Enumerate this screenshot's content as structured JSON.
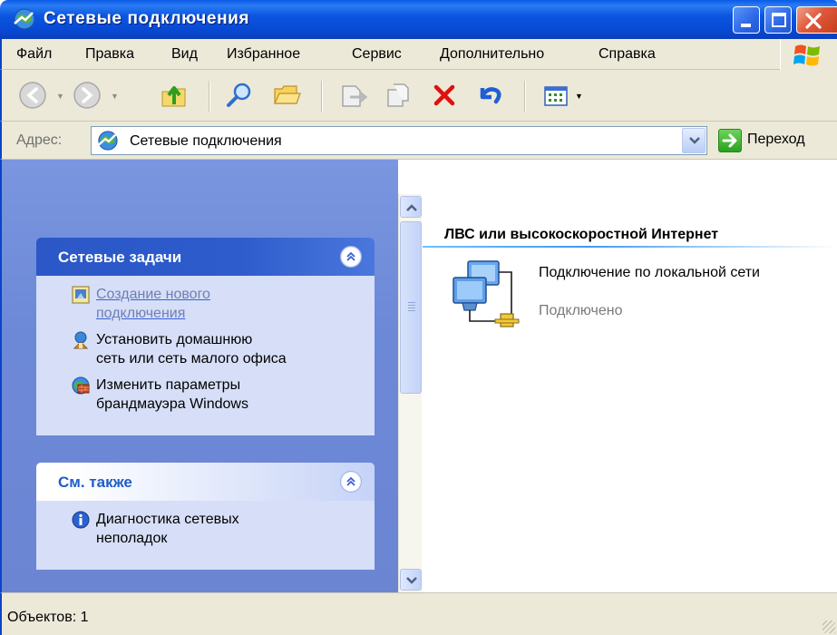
{
  "window": {
    "title": "Сетевые подключения",
    "controls": {
      "minimize": "minimize",
      "maximize": "maximize",
      "close": "close"
    }
  },
  "menu": {
    "items": [
      "Файл",
      "Правка",
      "Вид",
      "Избранное",
      "Сервис",
      "Дополнительно",
      "Справка"
    ]
  },
  "toolbar": {
    "icons": [
      "back-icon",
      "forward-icon",
      "up-folder-icon",
      "search-icon",
      "folders-icon",
      "move-to-icon",
      "copy-to-icon",
      "delete-icon",
      "undo-icon",
      "views-icon"
    ]
  },
  "address": {
    "label": "Адрес:",
    "value": "Сетевые подключения",
    "go_label": "Переход"
  },
  "left_pane": {
    "network_tasks": {
      "title": "Сетевые задачи",
      "items": [
        {
          "line1": "Создание нового",
          "line2": "подключения",
          "icon": "new-connection-icon",
          "disabled": true
        },
        {
          "line1": "Установить домашнюю",
          "line2": "сеть или сеть малого офиса",
          "icon": "home-network-icon"
        },
        {
          "line1": "Изменить параметры",
          "line2": "брандмауэра Windows",
          "icon": "firewall-icon"
        }
      ]
    },
    "see_also": {
      "title": "См. также",
      "items": [
        {
          "line1": "Диагностика сетевых",
          "line2": "неполадок",
          "icon": "info-icon"
        }
      ]
    }
  },
  "right_pane": {
    "group_title": "ЛВС или высокоскоростной Интернет",
    "connection": {
      "name": "Подключение по локальной сети",
      "status": "Подключено"
    }
  },
  "status_bar": {
    "text": "Объектов: 1"
  },
  "colors": {
    "titlebar": "#0b56e2",
    "task_pane": "#6c89d8",
    "panel_body": "#d6dff7",
    "link": "#3a5ed6",
    "delete_red": "#e01010"
  }
}
